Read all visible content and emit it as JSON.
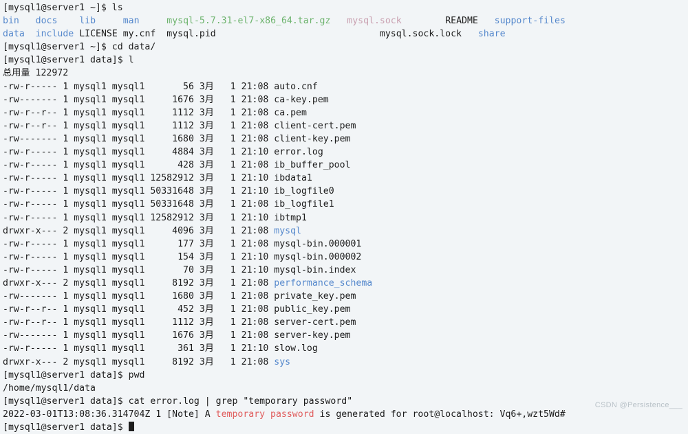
{
  "terminal": {
    "background_color": "#f2f5f7",
    "foreground_color": "#1c1c1c",
    "colors": {
      "directory": "#5588cc",
      "archive": "#6cb36c",
      "socket": "#c9a0b0",
      "grep_match": "#e05c5c"
    },
    "prompt_home": "[mysql1@server1 ~]$ ",
    "prompt_data": "[mysql1@server1 data]$ ",
    "commands": {
      "ls": "ls",
      "cd": "cd data/",
      "l": "l",
      "pwd": "pwd",
      "cat_grep": "cat error.log | grep \"temporary password\""
    },
    "ls_output": {
      "row1": [
        {
          "text": "bin",
          "type": "directory"
        },
        {
          "text": "docs",
          "type": "directory"
        },
        {
          "text": "lib",
          "type": "directory"
        },
        {
          "text": "man",
          "type": "directory"
        },
        {
          "text": "mysql-5.7.31-el7-x86_64.tar.gz",
          "type": "archive"
        },
        {
          "text": "mysql.sock",
          "type": "socket"
        },
        {
          "text": "README",
          "type": "plain"
        },
        {
          "text": "support-files",
          "type": "directory"
        }
      ],
      "row2": [
        {
          "text": "data",
          "type": "directory"
        },
        {
          "text": "include",
          "type": "directory"
        },
        {
          "text": "LICENSE",
          "type": "plain"
        },
        {
          "text": "my.cnf",
          "type": "plain"
        },
        {
          "text": "mysql.pid",
          "type": "plain"
        },
        {
          "text": "mysql.sock.lock",
          "type": "plain"
        },
        {
          "text": "share",
          "type": "directory"
        }
      ]
    },
    "total_label": "总用量",
    "total_value": "122972",
    "listing_columns": [
      "perms",
      "links",
      "owner",
      "group",
      "size",
      "month",
      "day",
      "time",
      "name"
    ],
    "listing": [
      {
        "perms": "-rw-r-----",
        "links": "1",
        "owner": "mysql1",
        "group": "mysql1",
        "size": "56",
        "month": "3月",
        "day": "1",
        "time": "21:08",
        "name": "auto.cnf",
        "type": "plain"
      },
      {
        "perms": "-rw-------",
        "links": "1",
        "owner": "mysql1",
        "group": "mysql1",
        "size": "1676",
        "month": "3月",
        "day": "1",
        "time": "21:08",
        "name": "ca-key.pem",
        "type": "plain"
      },
      {
        "perms": "-rw-r--r--",
        "links": "1",
        "owner": "mysql1",
        "group": "mysql1",
        "size": "1112",
        "month": "3月",
        "day": "1",
        "time": "21:08",
        "name": "ca.pem",
        "type": "plain"
      },
      {
        "perms": "-rw-r--r--",
        "links": "1",
        "owner": "mysql1",
        "group": "mysql1",
        "size": "1112",
        "month": "3月",
        "day": "1",
        "time": "21:08",
        "name": "client-cert.pem",
        "type": "plain"
      },
      {
        "perms": "-rw-------",
        "links": "1",
        "owner": "mysql1",
        "group": "mysql1",
        "size": "1680",
        "month": "3月",
        "day": "1",
        "time": "21:08",
        "name": "client-key.pem",
        "type": "plain"
      },
      {
        "perms": "-rw-r-----",
        "links": "1",
        "owner": "mysql1",
        "group": "mysql1",
        "size": "4884",
        "month": "3月",
        "day": "1",
        "time": "21:10",
        "name": "error.log",
        "type": "plain"
      },
      {
        "perms": "-rw-r-----",
        "links": "1",
        "owner": "mysql1",
        "group": "mysql1",
        "size": "428",
        "month": "3月",
        "day": "1",
        "time": "21:08",
        "name": "ib_buffer_pool",
        "type": "plain"
      },
      {
        "perms": "-rw-r-----",
        "links": "1",
        "owner": "mysql1",
        "group": "mysql1",
        "size": "12582912",
        "month": "3月",
        "day": "1",
        "time": "21:10",
        "name": "ibdata1",
        "type": "plain"
      },
      {
        "perms": "-rw-r-----",
        "links": "1",
        "owner": "mysql1",
        "group": "mysql1",
        "size": "50331648",
        "month": "3月",
        "day": "1",
        "time": "21:10",
        "name": "ib_logfile0",
        "type": "plain"
      },
      {
        "perms": "-rw-r-----",
        "links": "1",
        "owner": "mysql1",
        "group": "mysql1",
        "size": "50331648",
        "month": "3月",
        "day": "1",
        "time": "21:08",
        "name": "ib_logfile1",
        "type": "plain"
      },
      {
        "perms": "-rw-r-----",
        "links": "1",
        "owner": "mysql1",
        "group": "mysql1",
        "size": "12582912",
        "month": "3月",
        "day": "1",
        "time": "21:10",
        "name": "ibtmp1",
        "type": "plain"
      },
      {
        "perms": "drwxr-x---",
        "links": "2",
        "owner": "mysql1",
        "group": "mysql1",
        "size": "4096",
        "month": "3月",
        "day": "1",
        "time": "21:08",
        "name": "mysql",
        "type": "directory"
      },
      {
        "perms": "-rw-r-----",
        "links": "1",
        "owner": "mysql1",
        "group": "mysql1",
        "size": "177",
        "month": "3月",
        "day": "1",
        "time": "21:08",
        "name": "mysql-bin.000001",
        "type": "plain"
      },
      {
        "perms": "-rw-r-----",
        "links": "1",
        "owner": "mysql1",
        "group": "mysql1",
        "size": "154",
        "month": "3月",
        "day": "1",
        "time": "21:10",
        "name": "mysql-bin.000002",
        "type": "plain"
      },
      {
        "perms": "-rw-r-----",
        "links": "1",
        "owner": "mysql1",
        "group": "mysql1",
        "size": "70",
        "month": "3月",
        "day": "1",
        "time": "21:10",
        "name": "mysql-bin.index",
        "type": "plain"
      },
      {
        "perms": "drwxr-x---",
        "links": "2",
        "owner": "mysql1",
        "group": "mysql1",
        "size": "8192",
        "month": "3月",
        "day": "1",
        "time": "21:08",
        "name": "performance_schema",
        "type": "directory"
      },
      {
        "perms": "-rw-------",
        "links": "1",
        "owner": "mysql1",
        "group": "mysql1",
        "size": "1680",
        "month": "3月",
        "day": "1",
        "time": "21:08",
        "name": "private_key.pem",
        "type": "plain"
      },
      {
        "perms": "-rw-r--r--",
        "links": "1",
        "owner": "mysql1",
        "group": "mysql1",
        "size": "452",
        "month": "3月",
        "day": "1",
        "time": "21:08",
        "name": "public_key.pem",
        "type": "plain"
      },
      {
        "perms": "-rw-r--r--",
        "links": "1",
        "owner": "mysql1",
        "group": "mysql1",
        "size": "1112",
        "month": "3月",
        "day": "1",
        "time": "21:08",
        "name": "server-cert.pem",
        "type": "plain"
      },
      {
        "perms": "-rw-------",
        "links": "1",
        "owner": "mysql1",
        "group": "mysql1",
        "size": "1676",
        "month": "3月",
        "day": "1",
        "time": "21:08",
        "name": "server-key.pem",
        "type": "plain"
      },
      {
        "perms": "-rw-r-----",
        "links": "1",
        "owner": "mysql1",
        "group": "mysql1",
        "size": "361",
        "month": "3月",
        "day": "1",
        "time": "21:10",
        "name": "slow.log",
        "type": "plain"
      },
      {
        "perms": "drwxr-x---",
        "links": "2",
        "owner": "mysql1",
        "group": "mysql1",
        "size": "8192",
        "month": "3月",
        "day": "1",
        "time": "21:08",
        "name": "sys",
        "type": "directory"
      }
    ],
    "pwd_output": "/home/mysql1/data",
    "grep_result": {
      "prefix": "2022-03-01T13:08:36.314704Z 1 [Note] A ",
      "match": "temporary password",
      "suffix": " is generated for root@localhost: Vq6+,wzt5Wd#",
      "password": "Vq6+,wzt5Wd#"
    }
  },
  "watermark": "CSDN @Persistence___"
}
